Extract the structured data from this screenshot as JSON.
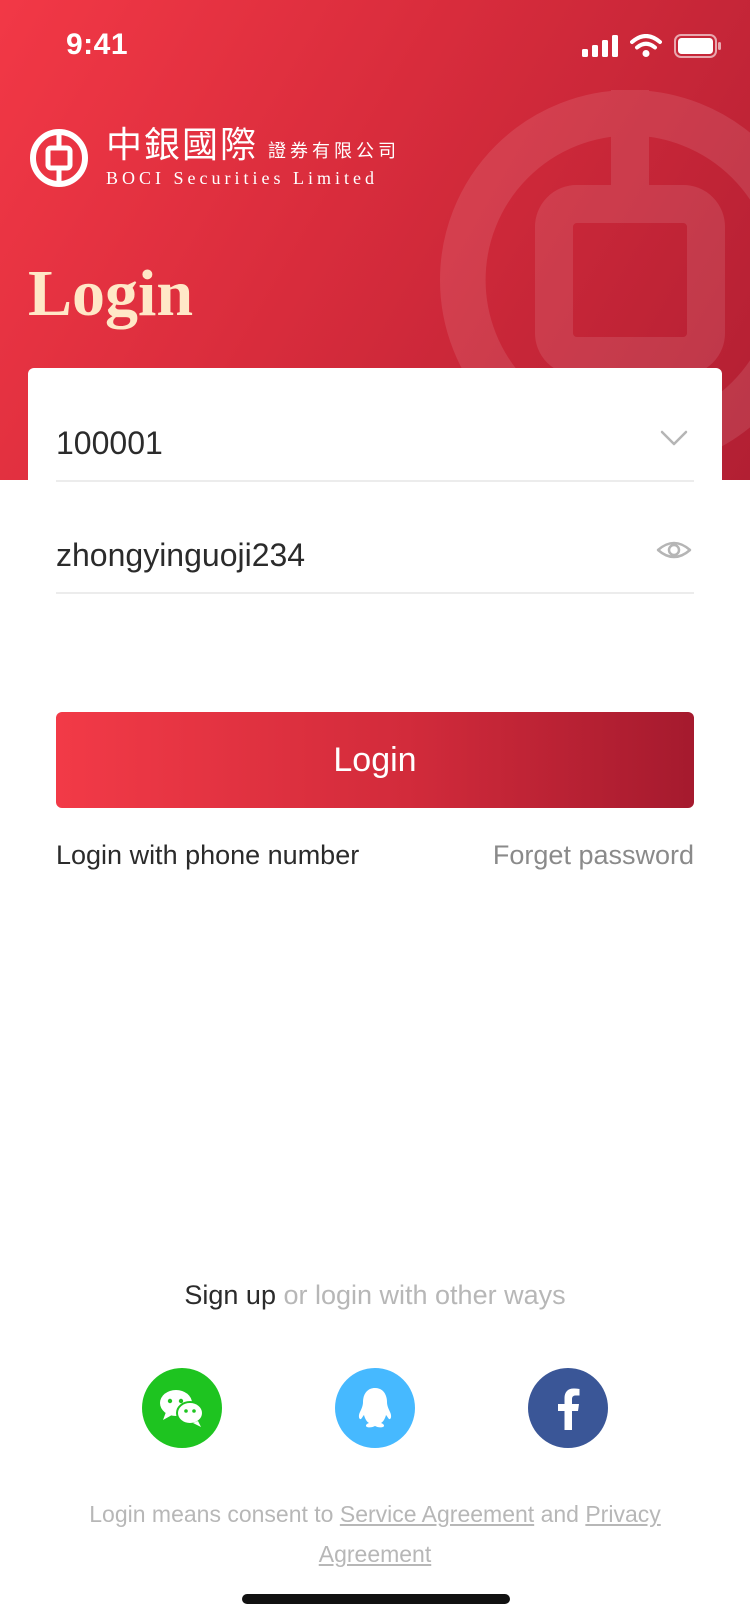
{
  "status_bar": {
    "time": "9:41"
  },
  "brand": {
    "name_cn": "中銀國際",
    "name_cn_sub": "證券有限公司",
    "name_en": "BOCI Securities Limited"
  },
  "page": {
    "title": "Login"
  },
  "form": {
    "account_value": "100001",
    "password_value": "zhongyinguoji234",
    "submit_label": "Login",
    "phone_login_label": "Login with phone number",
    "forget_password_label": "Forget password"
  },
  "signup": {
    "signup_label": "Sign up",
    "other_ways_label": " or login with other ways"
  },
  "social": [
    {
      "name": "WeChat",
      "icon": "wechat-icon",
      "color": "#1ec420"
    },
    {
      "name": "QQ",
      "icon": "qq-icon",
      "color": "#46b9ff"
    },
    {
      "name": "Facebook",
      "icon": "facebook-icon",
      "color": "#3a5697"
    }
  ],
  "consent": {
    "prefix": "Login means consent to ",
    "service_link": "Service Agreement",
    "connector": " and ",
    "privacy_link": "Privacy Agreement"
  },
  "colors": {
    "brand_red": "#f23846",
    "brand_red_dark": "#a51a2e",
    "title_cream": "#ffe8c7"
  }
}
